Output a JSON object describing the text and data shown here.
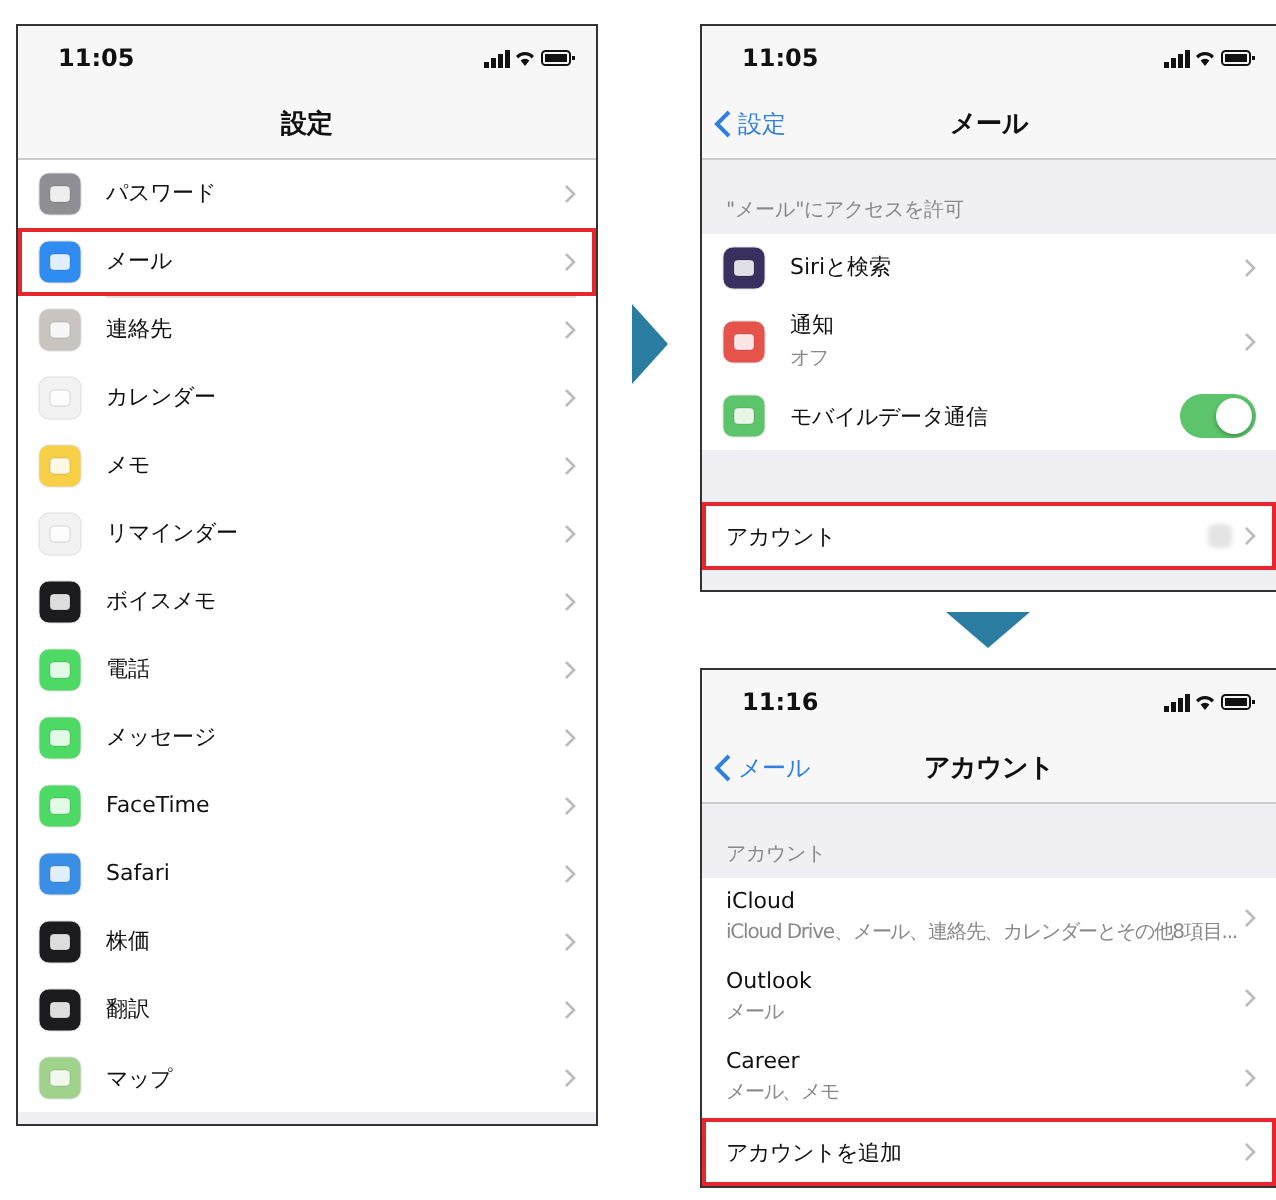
{
  "screens": [
    {
      "status_time": "11:05",
      "nav": {
        "title": "設定"
      },
      "sections": [
        {
          "rows": [
            {
              "label": "パスワード",
              "color": "#8e8e93",
              "kind": "link",
              "highlighted": false,
              "redacted": false
            },
            {
              "label": "メール",
              "color": "#2f8cf0",
              "kind": "link",
              "highlighted": true,
              "redacted": false
            },
            {
              "label": "連絡先",
              "color": "#c8c4bf",
              "kind": "link",
              "highlighted": false,
              "redacted": false
            },
            {
              "label": "カレンダー",
              "color": "#f2f2f2",
              "kind": "link",
              "highlighted": false,
              "redacted": false
            },
            {
              "label": "メモ",
              "color": "#f7d046",
              "kind": "link",
              "highlighted": false,
              "redacted": false
            },
            {
              "label": "リマインダー",
              "color": "#f2f2f2",
              "kind": "link",
              "highlighted": false,
              "redacted": false
            },
            {
              "label": "ボイスメモ",
              "color": "#1c1c1e",
              "kind": "link",
              "highlighted": false,
              "redacted": false
            },
            {
              "label": "電話",
              "color": "#4cd964",
              "kind": "link",
              "highlighted": false,
              "redacted": false
            },
            {
              "label": "メッセージ",
              "color": "#4cd964",
              "kind": "link",
              "highlighted": false,
              "redacted": false
            },
            {
              "label": "FaceTime",
              "color": "#4cd964",
              "kind": "link",
              "highlighted": false,
              "redacted": false
            },
            {
              "label": "Safari",
              "color": "#3a8ee6",
              "kind": "link",
              "highlighted": false,
              "redacted": false
            },
            {
              "label": "株価",
              "color": "#1c1c1e",
              "kind": "link",
              "highlighted": false,
              "redacted": false
            },
            {
              "label": "翻訳",
              "color": "#1c1c1e",
              "kind": "link",
              "highlighted": false,
              "redacted": false
            },
            {
              "label": "マップ",
              "color": "#9fd28a",
              "kind": "link",
              "highlighted": false,
              "redacted": false
            }
          ]
        }
      ]
    },
    {
      "status_time": "11:05",
      "nav": {
        "back": "設定",
        "title": "メール"
      },
      "sections": [
        {
          "header": "\"メール\"にアクセスを許可",
          "rows": [
            {
              "label": "Siriと検索",
              "color": "#3a3060",
              "kind": "link",
              "highlighted": false,
              "redacted": false
            },
            {
              "label": "通知",
              "sublabel": "オフ",
              "color": "#e5534b",
              "kind": "link",
              "highlighted": false,
              "redacted": false
            },
            {
              "label": "モバイルデータ通信",
              "color": "#5cc46a",
              "kind": "toggle",
              "on": true,
              "highlighted": false,
              "redacted": false
            }
          ]
        },
        {
          "rows": [
            {
              "label": "アカウント",
              "kind": "link",
              "highlighted": true,
              "redacted": true
            }
          ]
        }
      ]
    },
    {
      "status_time": "11:16",
      "nav": {
        "back": "メール",
        "title": "アカウント"
      },
      "sections": [
        {
          "header": "アカウント",
          "rows": [
            {
              "label": "iCloud",
              "sublabel": "iCloud Drive、メール、連絡先、カレンダーとその他8項目...",
              "kind": "link",
              "highlighted": false,
              "redacted": false
            },
            {
              "label": "Outlook",
              "sublabel": "メール",
              "kind": "link",
              "highlighted": false,
              "redacted": false
            },
            {
              "label": "Career",
              "sublabel": "メール、メモ",
              "kind": "link",
              "highlighted": false,
              "redacted": false
            },
            {
              "label": "アカウントを追加",
              "kind": "link",
              "highlighted": true,
              "redacted": false
            }
          ]
        }
      ]
    }
  ]
}
